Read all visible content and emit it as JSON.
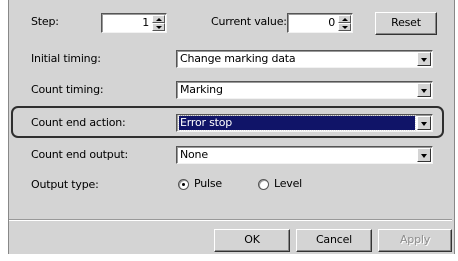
{
  "step": {
    "label": "Step:",
    "value": "1"
  },
  "current_value": {
    "label": "Current value:",
    "value": "0"
  },
  "buttons": {
    "reset": "Reset",
    "ok": "OK",
    "cancel": "Cancel",
    "apply": "Apply"
  },
  "fields": {
    "initial_timing": {
      "label": "Initial timing:",
      "value": "Change marking data"
    },
    "count_timing": {
      "label": "Count timing:",
      "value": "Marking"
    },
    "count_end_action": {
      "label": "Count end action:",
      "value": "Error stop"
    },
    "count_end_output": {
      "label": "Count end output:",
      "value": "None"
    }
  },
  "output_type": {
    "label": "Output type:",
    "options": [
      {
        "label": "Pulse",
        "checked": true
      },
      {
        "label": "Level",
        "checked": false
      }
    ]
  },
  "colors": {
    "dialog_bg": "#d4d4d4",
    "selection_bg": "#101468",
    "highlight_frame": "#2f2f2f"
  }
}
